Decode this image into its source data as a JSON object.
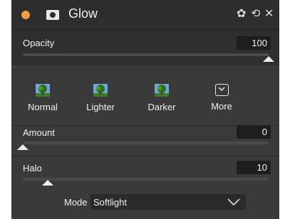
{
  "header": {
    "title": "Glow",
    "status_color": "#f29a3d",
    "icons": [
      "settings-gear-icon",
      "reset-undo-icon",
      "close-icon"
    ]
  },
  "opacity": {
    "label": "Opacity",
    "value": "100",
    "level": 1.0
  },
  "presets": [
    {
      "label": "Normal",
      "icon": "tree-thumbnail-icon"
    },
    {
      "label": "Lighter",
      "icon": "tree-thumbnail-icon"
    },
    {
      "label": "Darker",
      "icon": "tree-thumbnail-icon"
    },
    {
      "label": "More",
      "icon": "chevron-down-box-icon"
    }
  ],
  "amount": {
    "label": "Amount",
    "value": "0",
    "level": 0.0
  },
  "halo": {
    "label": "Halo",
    "value": "10",
    "level": 0.1
  },
  "mode": {
    "label": "Mode",
    "value": "Softlight"
  }
}
